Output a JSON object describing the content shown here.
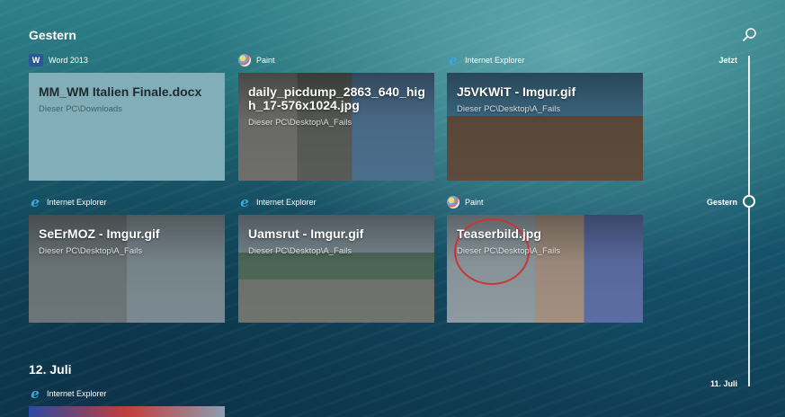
{
  "sections": {
    "yesterday": "Gestern",
    "july12": "12. Juli"
  },
  "timeline": {
    "now": "Jetzt",
    "yesterday": "Gestern",
    "july11": "11. Juli"
  },
  "cards": [
    {
      "app": "Word 2013",
      "icon": "word-icon",
      "title": "MM_WM Italien Finale.docx",
      "path": "Dieser PC\\Downloads"
    },
    {
      "app": "Paint",
      "icon": "paint-icon",
      "title": "daily_picdump_2863_640_high_17-576x1024.jpg",
      "path": "Dieser PC\\Desktop\\A_Fails"
    },
    {
      "app": "Internet Explorer",
      "icon": "internet-explorer-icon",
      "title": "J5VKWiT - Imgur.gif",
      "path": "Dieser PC\\Desktop\\A_Fails"
    },
    {
      "app": "Internet Explorer",
      "icon": "internet-explorer-icon",
      "title": "SeErMOZ - Imgur.gif",
      "path": "Dieser PC\\Desktop\\A_Fails"
    },
    {
      "app": "Internet Explorer",
      "icon": "internet-explorer-icon",
      "title": "Uamsrut - Imgur.gif",
      "path": "Dieser PC\\Desktop\\A_Fails"
    },
    {
      "app": "Paint",
      "icon": "paint-icon",
      "title": "Teaserbild.jpg",
      "path": "Dieser PC\\Desktop\\A_Fails"
    },
    {
      "app": "Internet Explorer",
      "icon": "internet-explorer-icon",
      "title": "",
      "path": ""
    }
  ]
}
